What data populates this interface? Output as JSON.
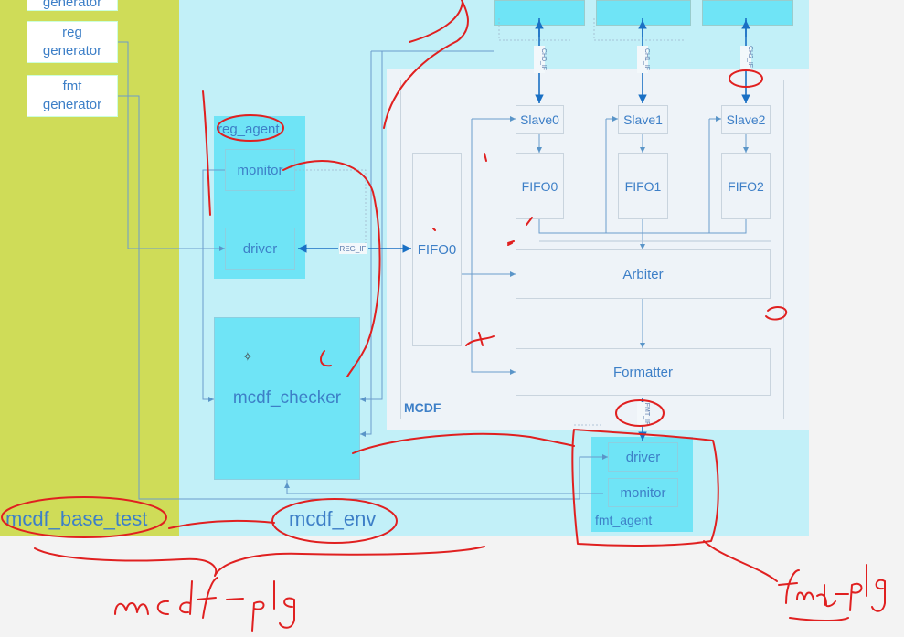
{
  "generators": {
    "top": "generator",
    "reg": "reg\ngenerator",
    "fmt": "fmt\ngenerator"
  },
  "reg_agent": {
    "title": "reg_agent",
    "monitor": "monitor",
    "driver": "driver"
  },
  "reg_if": "REG_IF",
  "checker": "mcdf_checker",
  "mcdf": {
    "title": "MCDF",
    "fifo0_main": "FIFO0",
    "slaves": [
      "Slave0",
      "Slave1",
      "Slave2"
    ],
    "fifos": [
      "FIFO0",
      "FIFO1",
      "FIFO2"
    ],
    "arbiter": "Arbiter",
    "formatter": "Formatter",
    "channel_ifs": [
      "CH0_IF",
      "CH1_IF",
      "CH2_IF"
    ],
    "fmt_if": "FMT_IF"
  },
  "fmt_agent": {
    "title": "fmt_agent",
    "driver": "driver",
    "monitor": "monitor"
  },
  "labels": {
    "base_test": "mcdf_base_test",
    "env": "mcdf_env"
  },
  "handwriting": {
    "left": "mcdf_pkg",
    "right": "fmt_pkg"
  },
  "colors": {
    "test_bg": "#cfdc58",
    "env_bg": "#c2f0f8",
    "agent_bg": "#6fe4f6",
    "ink_red": "#e02020",
    "text_blue": "#3d7fc7"
  }
}
